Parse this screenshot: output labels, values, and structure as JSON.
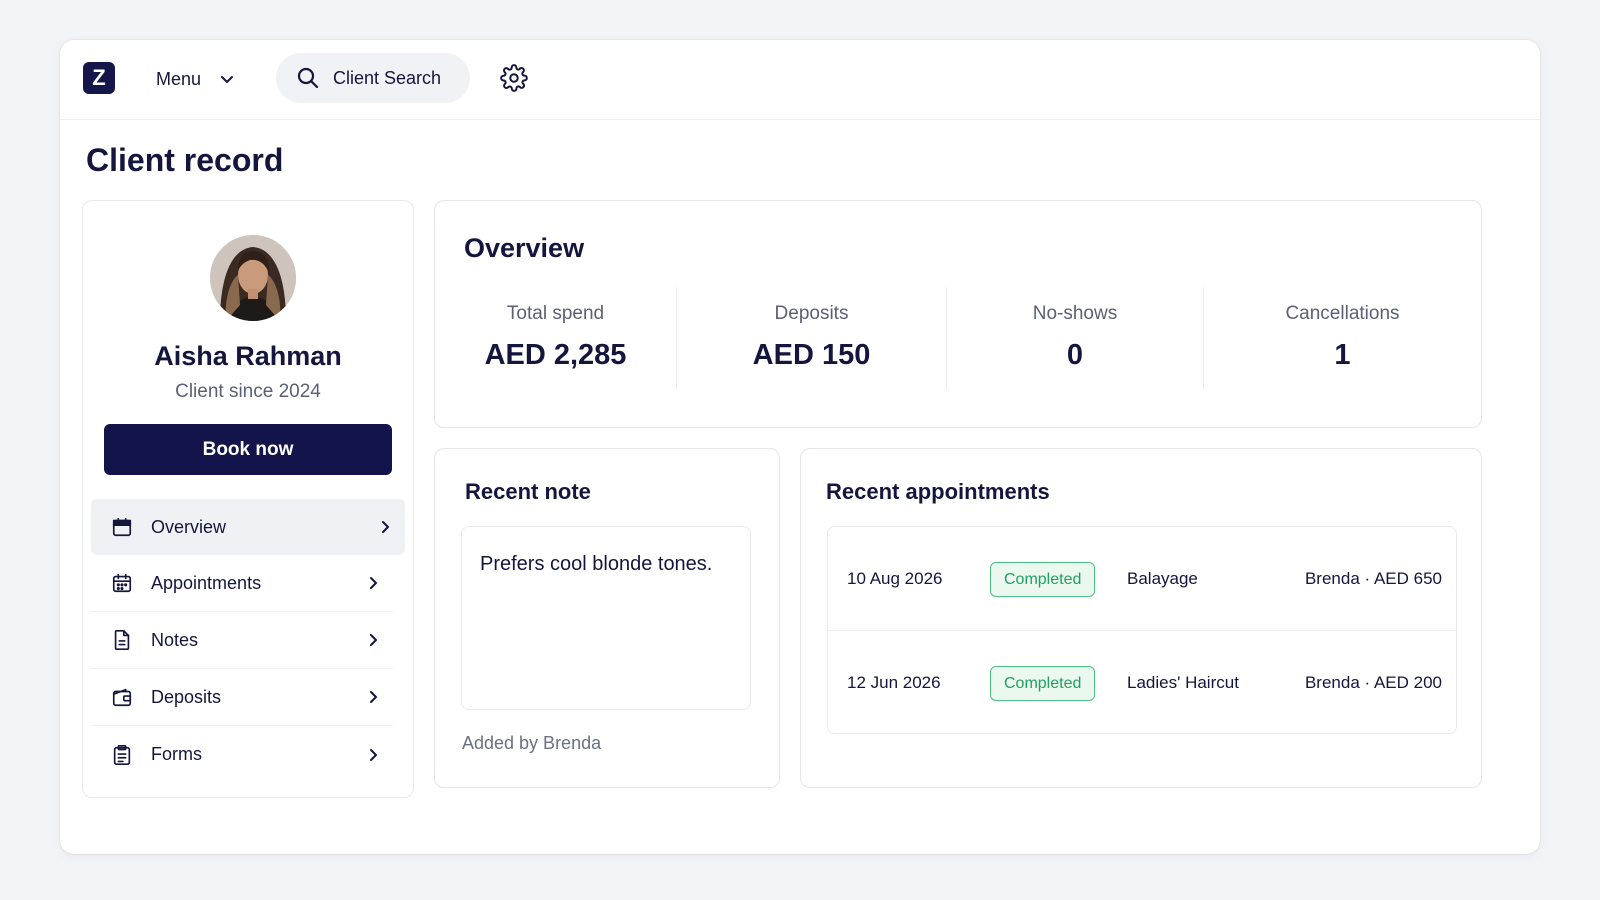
{
  "app": {
    "logo_letter": "Z"
  },
  "topbar": {
    "menu_label": "Menu",
    "search_label": "Client Search"
  },
  "page": {
    "title": "Client record"
  },
  "profile": {
    "name": "Aisha Rahman",
    "since": "Client since 2024",
    "book_label": "Book now",
    "nav": [
      {
        "label": "Overview",
        "icon": "calendar-filled-icon",
        "active": true
      },
      {
        "label": "Appointments",
        "icon": "calendar-grid-icon",
        "active": false
      },
      {
        "label": "Notes",
        "icon": "document-icon",
        "active": false
      },
      {
        "label": "Deposits",
        "icon": "wallet-icon",
        "active": false
      },
      {
        "label": "Forms",
        "icon": "clipboard-icon",
        "active": false
      }
    ]
  },
  "overview": {
    "title": "Overview",
    "stats": [
      {
        "label": "Total spend",
        "value": "AED 2,285"
      },
      {
        "label": "Deposits",
        "value": "AED 150"
      },
      {
        "label": "No-shows",
        "value": "0"
      },
      {
        "label": "Cancellations",
        "value": "1"
      }
    ]
  },
  "note": {
    "title": "Recent note",
    "text": "Prefers cool blonde tones.",
    "author": "Added by Brenda"
  },
  "appointments": {
    "title": "Recent appointments",
    "rows": [
      {
        "date": "10 Aug 2026",
        "status": "Completed",
        "service": "Balayage",
        "meta": "Brenda · AED 650"
      },
      {
        "date": "12 Jun 2026",
        "status": "Completed",
        "service": "Ladies' Haircut",
        "meta": "Brenda · AED 200"
      }
    ]
  },
  "colors": {
    "brand": "#12144a",
    "status_completed": "#23a060",
    "background": "#f3f4f7"
  }
}
